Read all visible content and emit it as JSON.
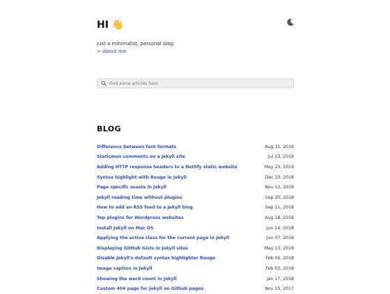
{
  "header": {
    "greeting": "HI",
    "wave_icon": "👋",
    "tagline": "just a minimalist, personal blog",
    "about_link": "> About me",
    "theme_toggle_icon": "moon-icon"
  },
  "search": {
    "placeholder": "Find some articles here"
  },
  "blog": {
    "title": "BLOG",
    "posts": [
      {
        "title": "Difference between font formats",
        "date": "Aug 31, 2019"
      },
      {
        "title": "Staticman comments on a Jekyll site",
        "date": "Jul 23, 2019"
      },
      {
        "title": "Adding HTTP response headers to a Netlify static website",
        "date": "May 23, 2019"
      },
      {
        "title": "Syntax highlight with Rouge in Jekyll",
        "date": "Dec 23, 2018"
      },
      {
        "title": "Page specific assets in Jekyll",
        "date": "Nov 12, 2018"
      },
      {
        "title": "Jekyll reading time without plugins",
        "date": "Sep 20, 2018"
      },
      {
        "title": "How to add an RSS feed to a Jekyll blog",
        "date": "Sep 11, 2018"
      },
      {
        "title": "Top plugins for Wordpress websites",
        "date": "Aug 18, 2018"
      },
      {
        "title": "Install Jekyll on Mac OS",
        "date": "Jun 14, 2018"
      },
      {
        "title": "Applying the active class for the current page in Jekyll",
        "date": "Jun 07, 2018"
      },
      {
        "title": "Displaying GitHub Gists in Jekyll sites",
        "date": "May 13, 2018"
      },
      {
        "title": "Disable Jekyll's default syntax highlighter Rouge",
        "date": "Feb 05, 2018"
      },
      {
        "title": "Image caption in Jekyll",
        "date": "Feb 03, 2018"
      },
      {
        "title": "Showing the word count in Jekyll",
        "date": "Jan 17, 2018"
      },
      {
        "title": "Custom 404 page for Jekyll on Github pages",
        "date": "Nov 15, 2017"
      }
    ]
  },
  "colors": {
    "link": "#2b50c6",
    "search_bg": "#efefef"
  }
}
